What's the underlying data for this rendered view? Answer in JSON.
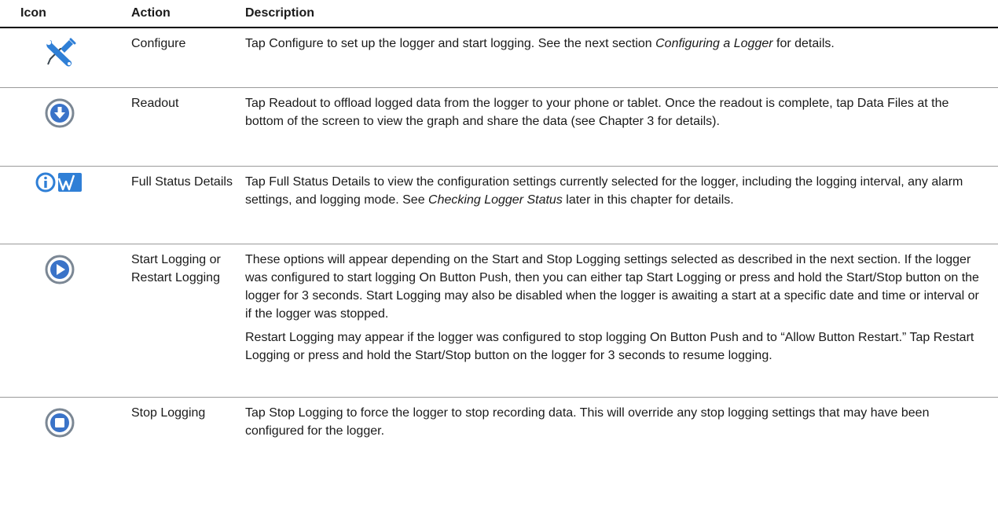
{
  "header": {
    "icon": "Icon",
    "action": "Action",
    "description": "Description"
  },
  "rows": [
    {
      "icon": "configure-wrench-icon",
      "action": "Configure",
      "desc": [
        {
          "t": "Tap Configure to set up the logger and start logging. See the next section "
        },
        {
          "t": "Configuring a Logger",
          "i": true
        },
        {
          "t": " for details."
        }
      ]
    },
    {
      "icon": "readout-arrow-down-icon",
      "action": "Readout",
      "desc": [
        {
          "t": "Tap Readout to offload logged data from the logger to your phone or tablet. Once the readout is complete, tap Data Files at the bottom of the screen to view the graph and share the data (see Chapter 3 for details)."
        }
      ]
    },
    {
      "icon": "full-status-info-icon",
      "action": "Full Status Details",
      "desc": [
        {
          "t": "Tap Full Status Details to view the configuration settings currently selected for the logger, including the logging interval, any alarm settings, and logging mode. See "
        },
        {
          "t": "Checking Logger Status",
          "i": true
        },
        {
          "t": " later in this chapter for details."
        }
      ]
    },
    {
      "icon": "start-play-icon",
      "action": "Start Logging or Restart Logging",
      "desc": [
        {
          "t": "These options will appear depending on the Start and Stop Logging settings selected as described in the next section. If the logger was configured to start logging On Button Push, then you can either tap Start Logging or press and hold the Start/Stop button on the logger for 3 seconds. Start Logging may also be disabled when the logger is awaiting a start at a specific date and time or interval or if the logger was stopped."
        }
      ],
      "desc2": "Restart Logging may appear if the logger was configured to stop logging On Button Push and to “Allow Button Restart.” Tap Restart Logging or press and hold the Start/Stop button on the logger for 3 seconds to resume logging."
    },
    {
      "icon": "stop-square-icon",
      "action": "Stop Logging",
      "desc": [
        {
          "t": "Tap Stop Logging to force the logger to stop recording data. This will override any stop logging settings that may have been configured for the logger."
        }
      ]
    }
  ],
  "colors": {
    "icon_blue": "#2f7fd6",
    "icon_gray": "#7b8794",
    "rule": "#9a9a9a"
  }
}
